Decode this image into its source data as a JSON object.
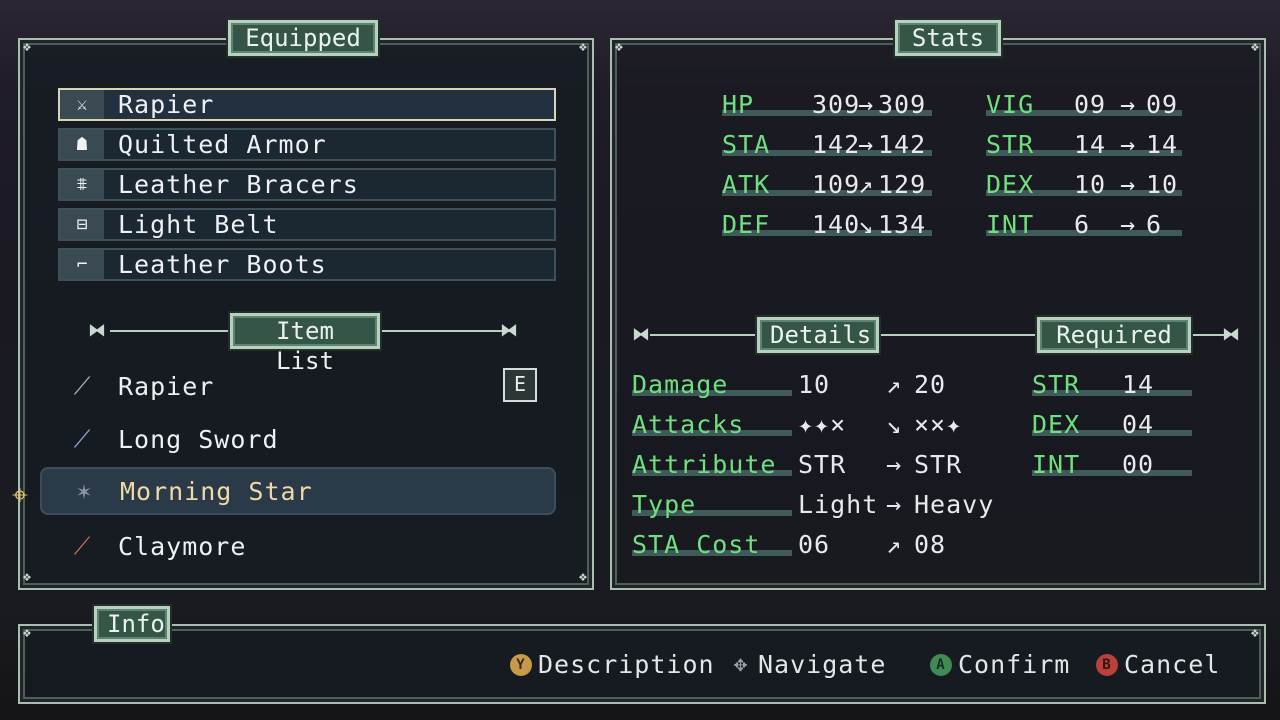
{
  "equipped_panel": {
    "title": "Equipped",
    "slots": [
      {
        "icon": "sword-icon",
        "glyph": "⚔",
        "label": "Rapier"
      },
      {
        "icon": "armor-icon",
        "glyph": "☗",
        "label": "Quilted Armor"
      },
      {
        "icon": "bracers-icon",
        "glyph": "⩨",
        "label": "Leather Bracers"
      },
      {
        "icon": "belt-icon",
        "glyph": "⊟",
        "label": "Light Belt"
      },
      {
        "icon": "boots-icon",
        "glyph": "⌐",
        "label": "Leather Boots"
      }
    ]
  },
  "item_list": {
    "title": "Item List",
    "equipped_badge": "E",
    "items": [
      {
        "icon": "rapier-icon",
        "glyph": "⟋",
        "label": "Rapier"
      },
      {
        "icon": "long-sword-icon",
        "glyph": "⟋",
        "label": "Long Sword"
      },
      {
        "icon": "morning-star-icon",
        "glyph": "✶",
        "label": "Morning Star"
      },
      {
        "icon": "claymore-icon",
        "glyph": "⟋",
        "label": "Claymore"
      }
    ]
  },
  "stats_panel": {
    "title": "Stats",
    "left": [
      {
        "label": "HP",
        "from": "309",
        "arrow": "→",
        "to": "309",
        "trend": "same"
      },
      {
        "label": "STA",
        "from": "142",
        "arrow": "→",
        "to": "142",
        "trend": "same"
      },
      {
        "label": "ATK",
        "from": "109",
        "arrow": "↗",
        "to": "129",
        "trend": "up"
      },
      {
        "label": "DEF",
        "from": "140",
        "arrow": "↘",
        "to": "134",
        "trend": "down"
      }
    ],
    "right": [
      {
        "label": "VIG",
        "from": "09",
        "arrow": "→",
        "to": "09"
      },
      {
        "label": "STR",
        "from": "14",
        "arrow": "→",
        "to": "14"
      },
      {
        "label": "DEX",
        "from": "10",
        "arrow": "→",
        "to": "10"
      },
      {
        "label": "INT",
        "from": "6",
        "arrow": "→",
        "to": "6"
      }
    ]
  },
  "details": {
    "title": "Details",
    "rows": [
      {
        "label": "Damage",
        "from": "10",
        "arrow": "↗",
        "to": "20"
      },
      {
        "label": "Attacks",
        "from": "✦✦×",
        "arrow": "↘",
        "to": "××✦"
      },
      {
        "label": "Attribute",
        "from": "STR",
        "arrow": "→",
        "to": "STR"
      },
      {
        "label": "Type",
        "from": "Light",
        "arrow": "→",
        "to": "Heavy"
      },
      {
        "label": "STA Cost",
        "from": "06",
        "arrow": "↗",
        "to": "08"
      }
    ]
  },
  "required": {
    "title": "Required",
    "rows": [
      {
        "label": "STR",
        "value": "14",
        "unmet": true
      },
      {
        "label": "DEX",
        "value": "04",
        "unmet": false
      },
      {
        "label": "INT",
        "value": "00",
        "unmet": false
      }
    ]
  },
  "info_panel": {
    "title": "Info",
    "hints": [
      {
        "button": "Y",
        "label": "Description",
        "color": "#c79a4a"
      },
      {
        "button": "✥",
        "label": "Navigate",
        "color": "#8a8f96"
      },
      {
        "button": "A",
        "label": "Confirm",
        "color": "#3f8a55"
      },
      {
        "button": "B",
        "label": "Cancel",
        "color": "#b8413d"
      }
    ]
  }
}
